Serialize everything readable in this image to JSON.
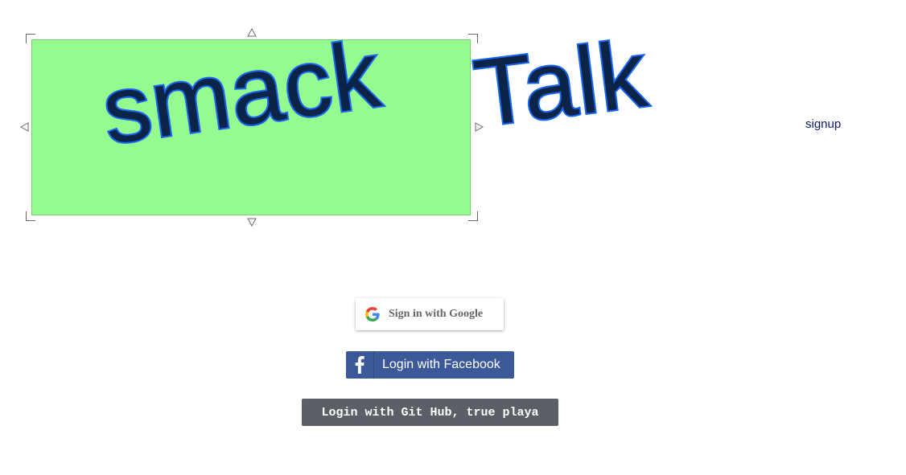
{
  "logo": {
    "word1": "smack",
    "word2": "Talk"
  },
  "nav": {
    "signup_label": "signup"
  },
  "auth": {
    "google_label": "Sign in with Google",
    "facebook_label": "Login with Facebook",
    "github_label": "Login with Git Hub, true playa"
  },
  "icons": {
    "google": "google-g-icon",
    "facebook": "facebook-f-icon",
    "resize_handles": "triangle-arrow-icon"
  },
  "colors": {
    "selection_fill": "#95fb8f",
    "logo_fill": "#0c2448",
    "logo_stroke": "#1867f6",
    "facebook_blue": "#3b5998",
    "github_gray": "#5b5f66",
    "signup_link": "#0b1a6a"
  }
}
